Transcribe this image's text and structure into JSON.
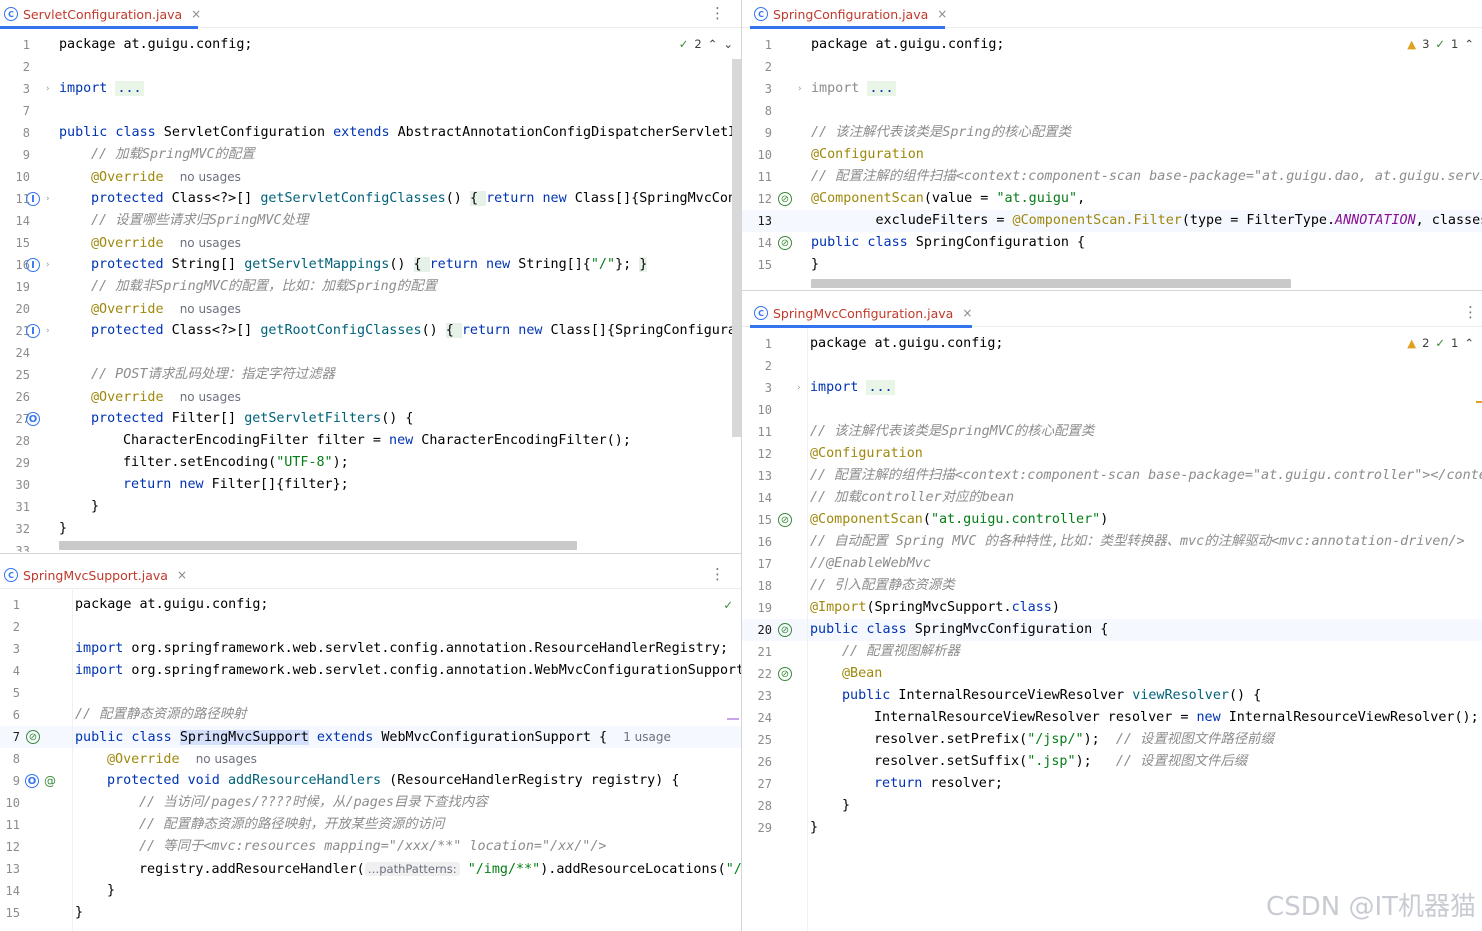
{
  "tabs": {
    "servlet": "ServletConfiguration.java",
    "spring": "SpringConfiguration.java",
    "springmvc": "SpringMvcConfiguration.java",
    "support": "SpringMvcSupport.java",
    "class_icon": "C",
    "close_glyph": "×",
    "menu_glyph": "⋮"
  },
  "badges": {
    "servlet_ok": "2",
    "spring_warn": "3",
    "spring_ok": "1",
    "springmvc_warn": "2",
    "springmvc_ok": "1"
  },
  "icons": {
    "run": "run-gutter-icon",
    "bean": "bean-gutter-icon",
    "override": "override-gutter-icon",
    "check": "check-icon",
    "warning": "warning-icon"
  },
  "hints": {
    "no_usages": "no usages",
    "one_usage": "1 usage",
    "path_patterns": "…pathPatterns:"
  },
  "servlet_lines": [
    "1",
    "2",
    "3",
    "7",
    "8",
    "9",
    "10",
    "11",
    "14",
    "15",
    "16",
    "19",
    "20",
    "21",
    "24",
    "25",
    "26",
    "27",
    "28",
    "29",
    "30",
    "31",
    "32",
    "33"
  ],
  "spring_lines": [
    "1",
    "2",
    "3",
    "8",
    "9",
    "10",
    "11",
    "12",
    "13",
    "14",
    "15"
  ],
  "springmvc_lines": [
    "1",
    "2",
    "3",
    "10",
    "11",
    "12",
    "13",
    "14",
    "15",
    "16",
    "17",
    "18",
    "19",
    "20",
    "21",
    "22",
    "23",
    "24",
    "25",
    "26",
    "27",
    "28",
    "29"
  ],
  "support_lines": [
    "1",
    "2",
    "3",
    "4",
    "5",
    "6",
    "7",
    "8",
    "9",
    "10",
    "11",
    "12",
    "13",
    "14",
    "15"
  ],
  "servlet_code": {
    "l1": "package at.guigu.config;",
    "l3_kw": "import",
    "l3_dots": "...",
    "l8_a": "public class",
    "l8_b": " ServletConfiguration ",
    "l8_c": "extends",
    "l8_d": " AbstractAnnotationConfigDispatcherServletIni",
    "l9": "// 加载SpringMVC的配置",
    "ovr": "@Override",
    "l11_a": "protected",
    "l11_b": " Class<?>[] ",
    "l11_c": "getServletConfigClasses",
    "l11_d": "() ",
    "l11_e": "{ ",
    "l11_f": "return new",
    "l11_g": " Class[]{SpringMvcConf",
    "l14": "// 设置哪些请求归SpringMVC处理",
    "l16_a": "protected",
    "l16_b": " String[] ",
    "l16_c": "getServletMappings",
    "l16_d": "() ",
    "l16_e": "{ ",
    "l16_f": "return new",
    "l16_g": " String[]{",
    "l16_h": "\"/\"",
    "l16_i": "}; ",
    "l16_j": "}",
    "l19": "// 加载非SpringMVC的配置，比如：加载Spring的配置",
    "l21_a": "protected",
    "l21_b": " Class<?>[] ",
    "l21_c": "getRootConfigClasses",
    "l21_d": "() ",
    "l21_e": "{ ",
    "l21_f": "return new",
    "l21_g": " Class[]{SpringConfigurati",
    "l25": "// POST请求乱码处理：指定字符过滤器",
    "l27_a": "protected",
    "l27_b": " Filter[] ",
    "l27_c": "getServletFilters",
    "l27_d": "() {",
    "l28_a": "CharacterEncodingFilter filter = ",
    "l28_b": "new",
    "l28_c": " CharacterEncodingFilter();",
    "l29_a": "filter.setEncoding(",
    "l29_b": "\"UTF-8\"",
    "l29_c": ");",
    "l30_a": "return new",
    "l30_b": " Filter[]{filter};",
    "l31": "}",
    "l32": "}"
  },
  "spring_code": {
    "l1": "package at.guigu.config;",
    "l3_kw": "import",
    "l3_dots": "...",
    "l9": "// 该注解代表该类是Spring的核心配置类",
    "l10": "@Configuration",
    "l11": "// 配置注解的组件扫描<context:component-scan base-package=\"at.guigu.dao, at.guigu.service",
    "l12_a": "@ComponentScan",
    "l12_b": "(value = ",
    "l12_c": "\"at.guigu\"",
    "l12_d": ",",
    "l13_a": "        excludeFilters = ",
    "l13_b": "@ComponentScan.Filter",
    "l13_c": "(type = FilterType.",
    "l13_d": "ANNOTATION",
    "l13_e": ", classes",
    "l14_a": "public class",
    "l14_b": " SpringConfiguration {",
    "l15": "}"
  },
  "springmvc_code": {
    "l1": "package at.guigu.config;",
    "l3_kw": "import",
    "l3_dots": "...",
    "l11": "// 该注解代表该类是SpringMVC的核心配置类",
    "l12": "@Configuration",
    "l13": "// 配置注解的组件扫描<context:component-scan base-package=\"at.guigu.controller\"></conte",
    "l14": "// 加载controller对应的bean",
    "l15_a": "@ComponentScan",
    "l15_b": "(",
    "l15_c": "\"at.guigu.controller\"",
    "l15_d": ")",
    "l16": "// 自动配置 Spring MVC 的各种特性,比如：类型转换器、mvc的注解驱动<mvc:annotation-driven/>",
    "l17": "//@EnableWebMvc",
    "l18": "// 引入配置静态资源类",
    "l19_a": "@Import",
    "l19_b": "(SpringMvcSupport.",
    "l19_c": "class",
    "l19_d": ")",
    "l20_a": "public class",
    "l20_b": " SpringMvcConfiguration {",
    "l21": "// 配置视图解析器",
    "l22": "@Bean",
    "l23_a": "public",
    "l23_b": " InternalResourceViewResolver ",
    "l23_c": "viewResolver",
    "l23_d": "() {",
    "l24_a": "InternalResourceViewResolver resolver = ",
    "l24_b": "new",
    "l24_c": " InternalResourceViewResolver();",
    "l25_a": "resolver.setPrefix(",
    "l25_b": "\"/jsp/\"",
    "l25_c": ");  ",
    "l25_d": "// 设置视图文件路径前缀",
    "l26_a": "resolver.setSuffix(",
    "l26_b": "\".jsp\"",
    "l26_c": ");   ",
    "l26_d": "// 设置视图文件后缀",
    "l27_a": "return",
    "l27_b": " resolver;",
    "l28": "}",
    "l29": "}"
  },
  "support_code": {
    "l1": "package at.guigu.config;",
    "l3_a": "import",
    "l3_b": " org.springframework.web.servlet.config.annotation.ResourceHandlerRegistry;",
    "l4_a": "import",
    "l4_b": " org.springframework.web.servlet.config.annotation.WebMvcConfigurationSupport",
    "l6": "// 配置静态资源的路径映射",
    "l7_a": "public class",
    "l7_b": " ",
    "l7_c": "SpringMvcSupport",
    "l7_d": " ",
    "l7_e": "extends",
    "l7_f": " WebMvcConfigurationSupport {",
    "l8": "@Override",
    "l9_a": "protected void",
    "l9_b": " ",
    "l9_c": "addResourceHandlers",
    "l9_d": " (ResourceHandlerRegistry registry) {",
    "l10": "// 当访问/pages/????时候，从/pages目录下查找内容",
    "l11": "// 配置静态资源的路径映射，开放某些资源的访问",
    "l12": "// 等同于<mvc:resources mapping=\"/xxx/**\" location=\"/xx/\"/>",
    "l13_a": "registry.addResourceHandler(",
    "l13_c": "\"/img/**\"",
    "l13_d": ").addResourceLocations(",
    "l13_e": "\"/i",
    "l14": "}",
    "l15": "}"
  },
  "watermark": "CSDN @IT机器猫"
}
